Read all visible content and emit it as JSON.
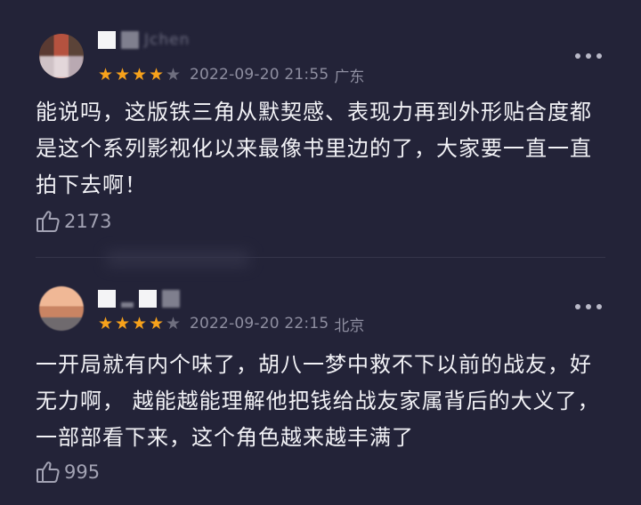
{
  "comments": [
    {
      "username_fragment": "Jchen",
      "rating_stars": 4,
      "rating_max": 5,
      "date": "2022-09-20 21:55",
      "region": "广东",
      "text": "能说吗，这版铁三角从默契感、表现力再到外形贴合度都是这个系列影视化以来最像书里边的了，大家要一直一直拍下去啊！",
      "likes": "2173"
    },
    {
      "username_fragment": "",
      "rating_stars": 4,
      "rating_max": 5,
      "date": "2022-09-20 22:15",
      "region": "北京",
      "text": "一开局就有内个味了，胡八一梦中救不下以前的战友，好无力啊， 越能越能理解他把钱给战友家属背后的大义了，一部部看下来，这个角色越来越丰满了",
      "likes": "995"
    }
  ],
  "colors": {
    "background": "#232338",
    "star_on": "#F7A21B",
    "star_off": "#6e6e7e",
    "meta_text": "#8e8ea0",
    "body_text": "#F2F2F6"
  },
  "icons": {
    "like": "thumbs-up-icon",
    "more": "more-dots-icon",
    "star": "star-icon"
  }
}
